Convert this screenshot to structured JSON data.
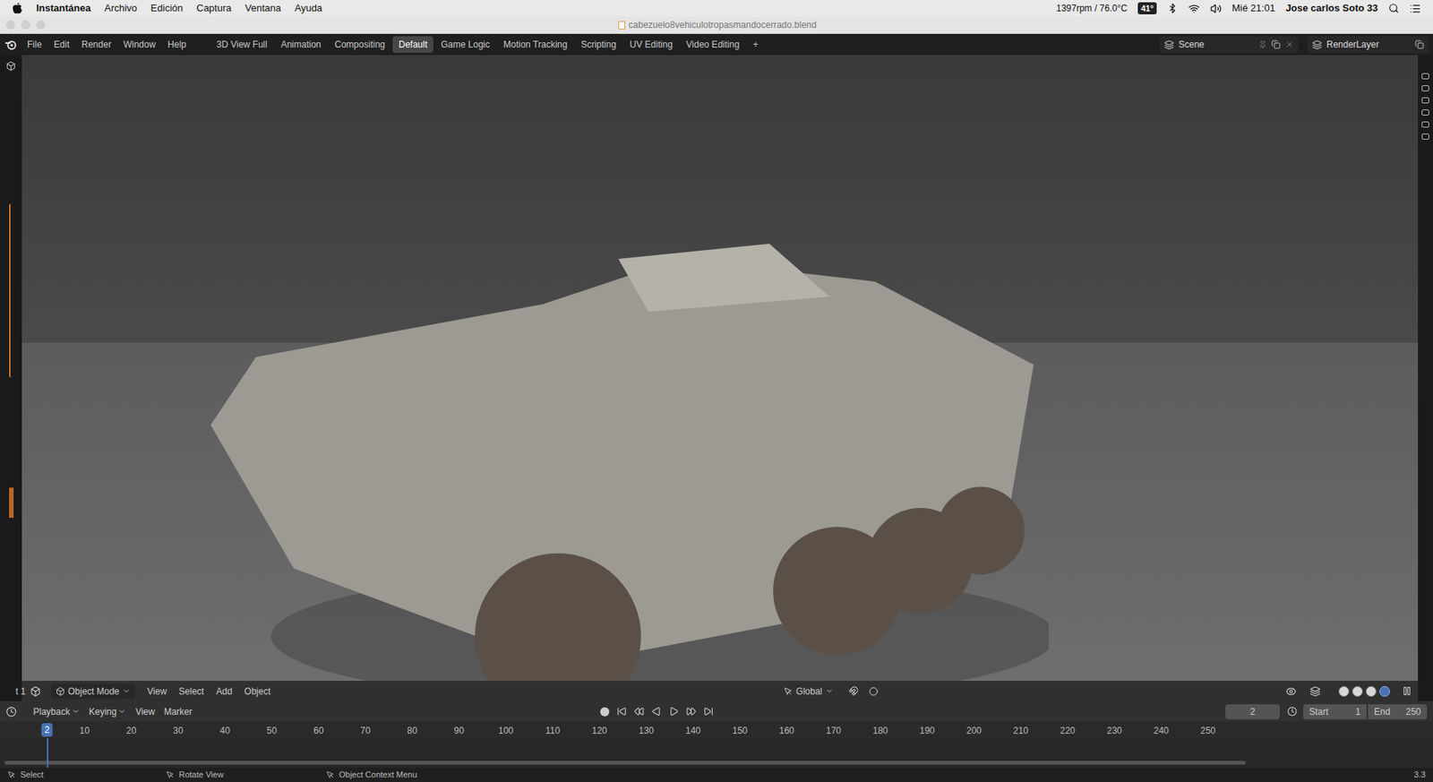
{
  "menubar": {
    "app": "Instantánea",
    "menus": [
      "Archivo",
      "Edición",
      "Captura",
      "Ventana",
      "Ayuda"
    ],
    "fan": "1397rpm / 76.0°C",
    "temp": "41°",
    "clock": "Mié 21:01",
    "user": "Jose carlos Soto 33"
  },
  "window": {
    "title": "cabezuelo8vehiculotropasmandocerrado.blend"
  },
  "topbar": {
    "menus": [
      "File",
      "Edit",
      "Render",
      "Window",
      "Help"
    ],
    "workspaces": [
      {
        "label": "3D View Full",
        "selected": false
      },
      {
        "label": "Animation",
        "selected": false
      },
      {
        "label": "Compositing",
        "selected": false
      },
      {
        "label": "Default",
        "selected": true
      },
      {
        "label": "Game Logic",
        "selected": false
      },
      {
        "label": "Motion Tracking",
        "selected": false
      },
      {
        "label": "Scripting",
        "selected": false
      },
      {
        "label": "UV Editing",
        "selected": false
      },
      {
        "label": "Video Editing",
        "selected": false
      }
    ],
    "add": "+",
    "scene": "Scene",
    "view_layer": "RenderLayer"
  },
  "viewport_header": {
    "cut_label": "t 1",
    "mode": "Object Mode",
    "menus": [
      "View",
      "Select",
      "Add",
      "Object"
    ],
    "orientation": "Global",
    "shading": [
      {
        "mode": "wireframe",
        "selected": false
      },
      {
        "mode": "solid",
        "selected": false
      },
      {
        "mode": "material",
        "selected": false
      },
      {
        "mode": "rendered",
        "selected": true
      }
    ]
  },
  "timeline": {
    "menus": [
      "Playback",
      "Keying",
      "View",
      "Marker"
    ],
    "current_frame": "2",
    "start_label": "Start",
    "start": "1",
    "end_label": "End",
    "end": "250",
    "ticks": [
      "10",
      "20",
      "30",
      "40",
      "50",
      "60",
      "70",
      "80",
      "90",
      "100",
      "110",
      "120",
      "130",
      "140",
      "150",
      "160",
      "170",
      "180",
      "190",
      "200",
      "210",
      "220",
      "230",
      "240",
      "250"
    ]
  },
  "status_bar": {
    "items": [
      "Select",
      "Rotate View",
      "Object Context Menu"
    ],
    "version": "3.3"
  }
}
